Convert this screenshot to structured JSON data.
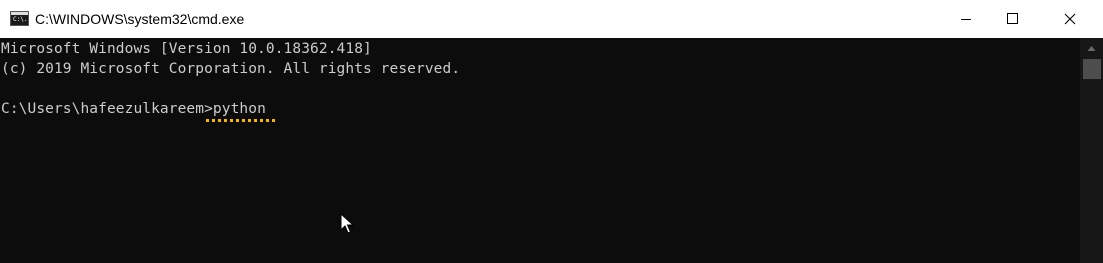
{
  "window": {
    "title": "C:\\WINDOWS\\system32\\cmd.exe",
    "icon": "cmd-prompt-icon",
    "icon_text": "C:\\.",
    "controls": [
      "minimize-icon",
      "maximize-icon",
      "close-icon"
    ]
  },
  "console": {
    "lines": [
      "Microsoft Windows [Version 10.0.18362.418]",
      "(c) 2019 Microsoft Corporation. All rights reserved."
    ],
    "prompt": "C:\\Users\\hafeezulkareem>",
    "command": "python",
    "text_color": "#cccccc",
    "background": "#0c0c0c",
    "underline_color": "#f7b500"
  },
  "scrollbar": {
    "up_arrow": "arrow-up-icon"
  }
}
